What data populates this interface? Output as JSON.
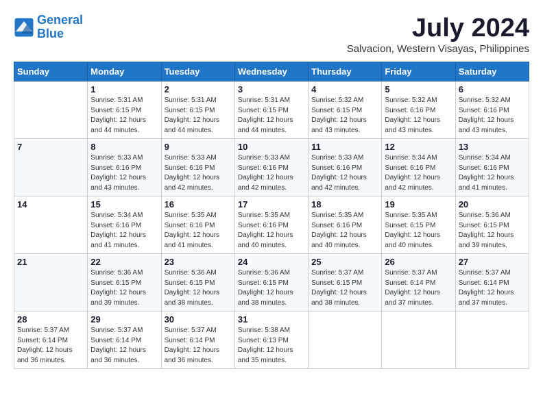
{
  "logo": {
    "line1": "General",
    "line2": "Blue"
  },
  "title": "July 2024",
  "location": "Salvacion, Western Visayas, Philippines",
  "header": {
    "days": [
      "Sunday",
      "Monday",
      "Tuesday",
      "Wednesday",
      "Thursday",
      "Friday",
      "Saturday"
    ]
  },
  "weeks": [
    [
      {
        "day": "",
        "info": ""
      },
      {
        "day": "1",
        "info": "Sunrise: 5:31 AM\nSunset: 6:15 PM\nDaylight: 12 hours\nand 44 minutes."
      },
      {
        "day": "2",
        "info": "Sunrise: 5:31 AM\nSunset: 6:15 PM\nDaylight: 12 hours\nand 44 minutes."
      },
      {
        "day": "3",
        "info": "Sunrise: 5:31 AM\nSunset: 6:15 PM\nDaylight: 12 hours\nand 44 minutes."
      },
      {
        "day": "4",
        "info": "Sunrise: 5:32 AM\nSunset: 6:15 PM\nDaylight: 12 hours\nand 43 minutes."
      },
      {
        "day": "5",
        "info": "Sunrise: 5:32 AM\nSunset: 6:16 PM\nDaylight: 12 hours\nand 43 minutes."
      },
      {
        "day": "6",
        "info": "Sunrise: 5:32 AM\nSunset: 6:16 PM\nDaylight: 12 hours\nand 43 minutes."
      }
    ],
    [
      {
        "day": "7",
        "info": ""
      },
      {
        "day": "8",
        "info": "Sunrise: 5:33 AM\nSunset: 6:16 PM\nDaylight: 12 hours\nand 43 minutes."
      },
      {
        "day": "9",
        "info": "Sunrise: 5:33 AM\nSunset: 6:16 PM\nDaylight: 12 hours\nand 42 minutes."
      },
      {
        "day": "10",
        "info": "Sunrise: 5:33 AM\nSunset: 6:16 PM\nDaylight: 12 hours\nand 42 minutes."
      },
      {
        "day": "11",
        "info": "Sunrise: 5:33 AM\nSunset: 6:16 PM\nDaylight: 12 hours\nand 42 minutes."
      },
      {
        "day": "12",
        "info": "Sunrise: 5:34 AM\nSunset: 6:16 PM\nDaylight: 12 hours\nand 42 minutes."
      },
      {
        "day": "13",
        "info": "Sunrise: 5:34 AM\nSunset: 6:16 PM\nDaylight: 12 hours\nand 41 minutes."
      }
    ],
    [
      {
        "day": "14",
        "info": ""
      },
      {
        "day": "15",
        "info": "Sunrise: 5:34 AM\nSunset: 6:16 PM\nDaylight: 12 hours\nand 41 minutes."
      },
      {
        "day": "16",
        "info": "Sunrise: 5:35 AM\nSunset: 6:16 PM\nDaylight: 12 hours\nand 41 minutes."
      },
      {
        "day": "17",
        "info": "Sunrise: 5:35 AM\nSunset: 6:16 PM\nDaylight: 12 hours\nand 40 minutes."
      },
      {
        "day": "18",
        "info": "Sunrise: 5:35 AM\nSunset: 6:16 PM\nDaylight: 12 hours\nand 40 minutes."
      },
      {
        "day": "19",
        "info": "Sunrise: 5:35 AM\nSunset: 6:15 PM\nDaylight: 12 hours\nand 40 minutes."
      },
      {
        "day": "20",
        "info": "Sunrise: 5:36 AM\nSunset: 6:15 PM\nDaylight: 12 hours\nand 39 minutes."
      }
    ],
    [
      {
        "day": "21",
        "info": ""
      },
      {
        "day": "22",
        "info": "Sunrise: 5:36 AM\nSunset: 6:15 PM\nDaylight: 12 hours\nand 39 minutes."
      },
      {
        "day": "23",
        "info": "Sunrise: 5:36 AM\nSunset: 6:15 PM\nDaylight: 12 hours\nand 38 minutes."
      },
      {
        "day": "24",
        "info": "Sunrise: 5:36 AM\nSunset: 6:15 PM\nDaylight: 12 hours\nand 38 minutes."
      },
      {
        "day": "25",
        "info": "Sunrise: 5:37 AM\nSunset: 6:15 PM\nDaylight: 12 hours\nand 38 minutes."
      },
      {
        "day": "26",
        "info": "Sunrise: 5:37 AM\nSunset: 6:14 PM\nDaylight: 12 hours\nand 37 minutes."
      },
      {
        "day": "27",
        "info": "Sunrise: 5:37 AM\nSunset: 6:14 PM\nDaylight: 12 hours\nand 37 minutes."
      }
    ],
    [
      {
        "day": "28",
        "info": "Sunrise: 5:37 AM\nSunset: 6:14 PM\nDaylight: 12 hours\nand 36 minutes."
      },
      {
        "day": "29",
        "info": "Sunrise: 5:37 AM\nSunset: 6:14 PM\nDaylight: 12 hours\nand 36 minutes."
      },
      {
        "day": "30",
        "info": "Sunrise: 5:37 AM\nSunset: 6:14 PM\nDaylight: 12 hours\nand 36 minutes."
      },
      {
        "day": "31",
        "info": "Sunrise: 5:38 AM\nSunset: 6:13 PM\nDaylight: 12 hours\nand 35 minutes."
      },
      {
        "day": "",
        "info": ""
      },
      {
        "day": "",
        "info": ""
      },
      {
        "day": "",
        "info": ""
      }
    ]
  ]
}
